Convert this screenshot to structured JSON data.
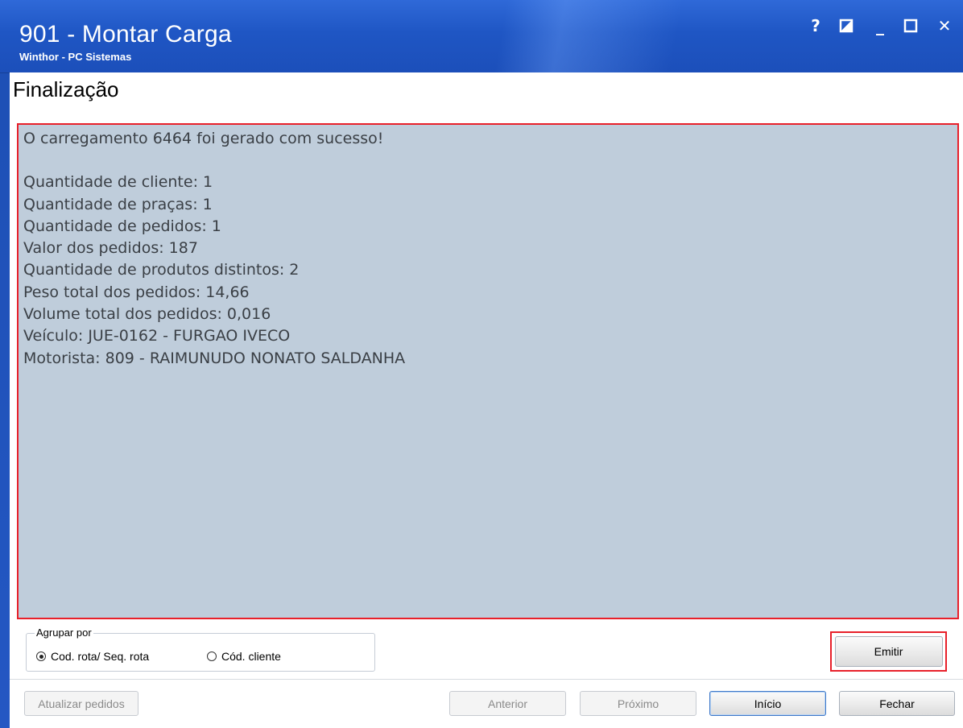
{
  "window": {
    "title": "901 - Montar Carga",
    "subtitle": "Winthor - PC Sistemas",
    "controls": {
      "help": "?",
      "restore_icon": "restore-icon",
      "minimize": "_",
      "maximize_icon": "maximize-icon",
      "close": "✕"
    },
    "accent_color": "#1f56c4"
  },
  "page": {
    "title": "Finalização"
  },
  "summary": {
    "headline": "O carregamento 6464 foi gerado com sucesso!",
    "lines": [
      "Quantidade de cliente: 1",
      "Quantidade de praças: 1",
      "Quantidade de pedidos: 1",
      "Valor dos pedidos: 187",
      "Quantidade de produtos distintos: 2",
      "Peso total dos pedidos: 14,66",
      "Volume total dos pedidos: 0,016",
      "Veículo: JUE-0162 - FURGAO IVECO",
      "Motorista: 809 - RAIMUNUDO NONATO SALDANHA"
    ],
    "highlight_color": "#e8202a",
    "background_color": "#bfcddb"
  },
  "grouping": {
    "legend": "Agrupar por",
    "options": [
      {
        "label": "Cod. rota/ Seq. rota",
        "selected": true
      },
      {
        "label": "Cód. cliente",
        "selected": false
      }
    ]
  },
  "actions": {
    "emit": "Emitir"
  },
  "footer": {
    "refresh": "Atualizar pedidos",
    "previous": "Anterior",
    "next": "Próximo",
    "start": "Início",
    "close": "Fechar"
  }
}
